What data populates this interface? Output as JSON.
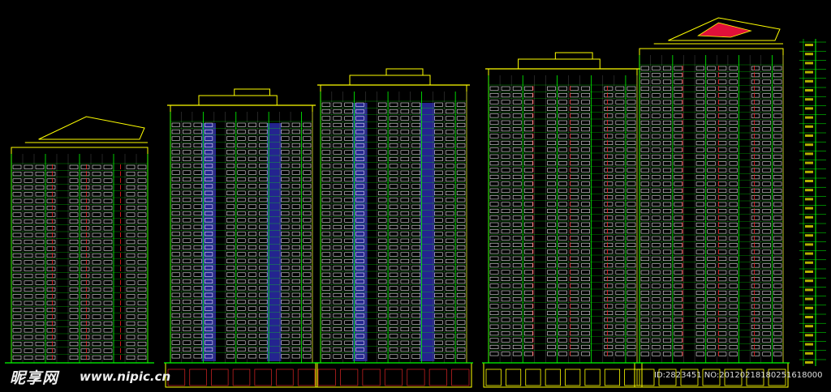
{
  "watermark": {
    "logo": "昵享网",
    "url": "www.nipic.cn",
    "id": "ID:2823451 NO:20120218180251618000"
  },
  "colors": {
    "background": "#000000",
    "window": "#ffffff",
    "outline": "#ffff00",
    "frame": "#00ff00",
    "accent_blue": "#2a2aa8",
    "accent_red": "#ff2020",
    "roof_red": "#e0103a",
    "ground_red": "#c02020"
  }
}
